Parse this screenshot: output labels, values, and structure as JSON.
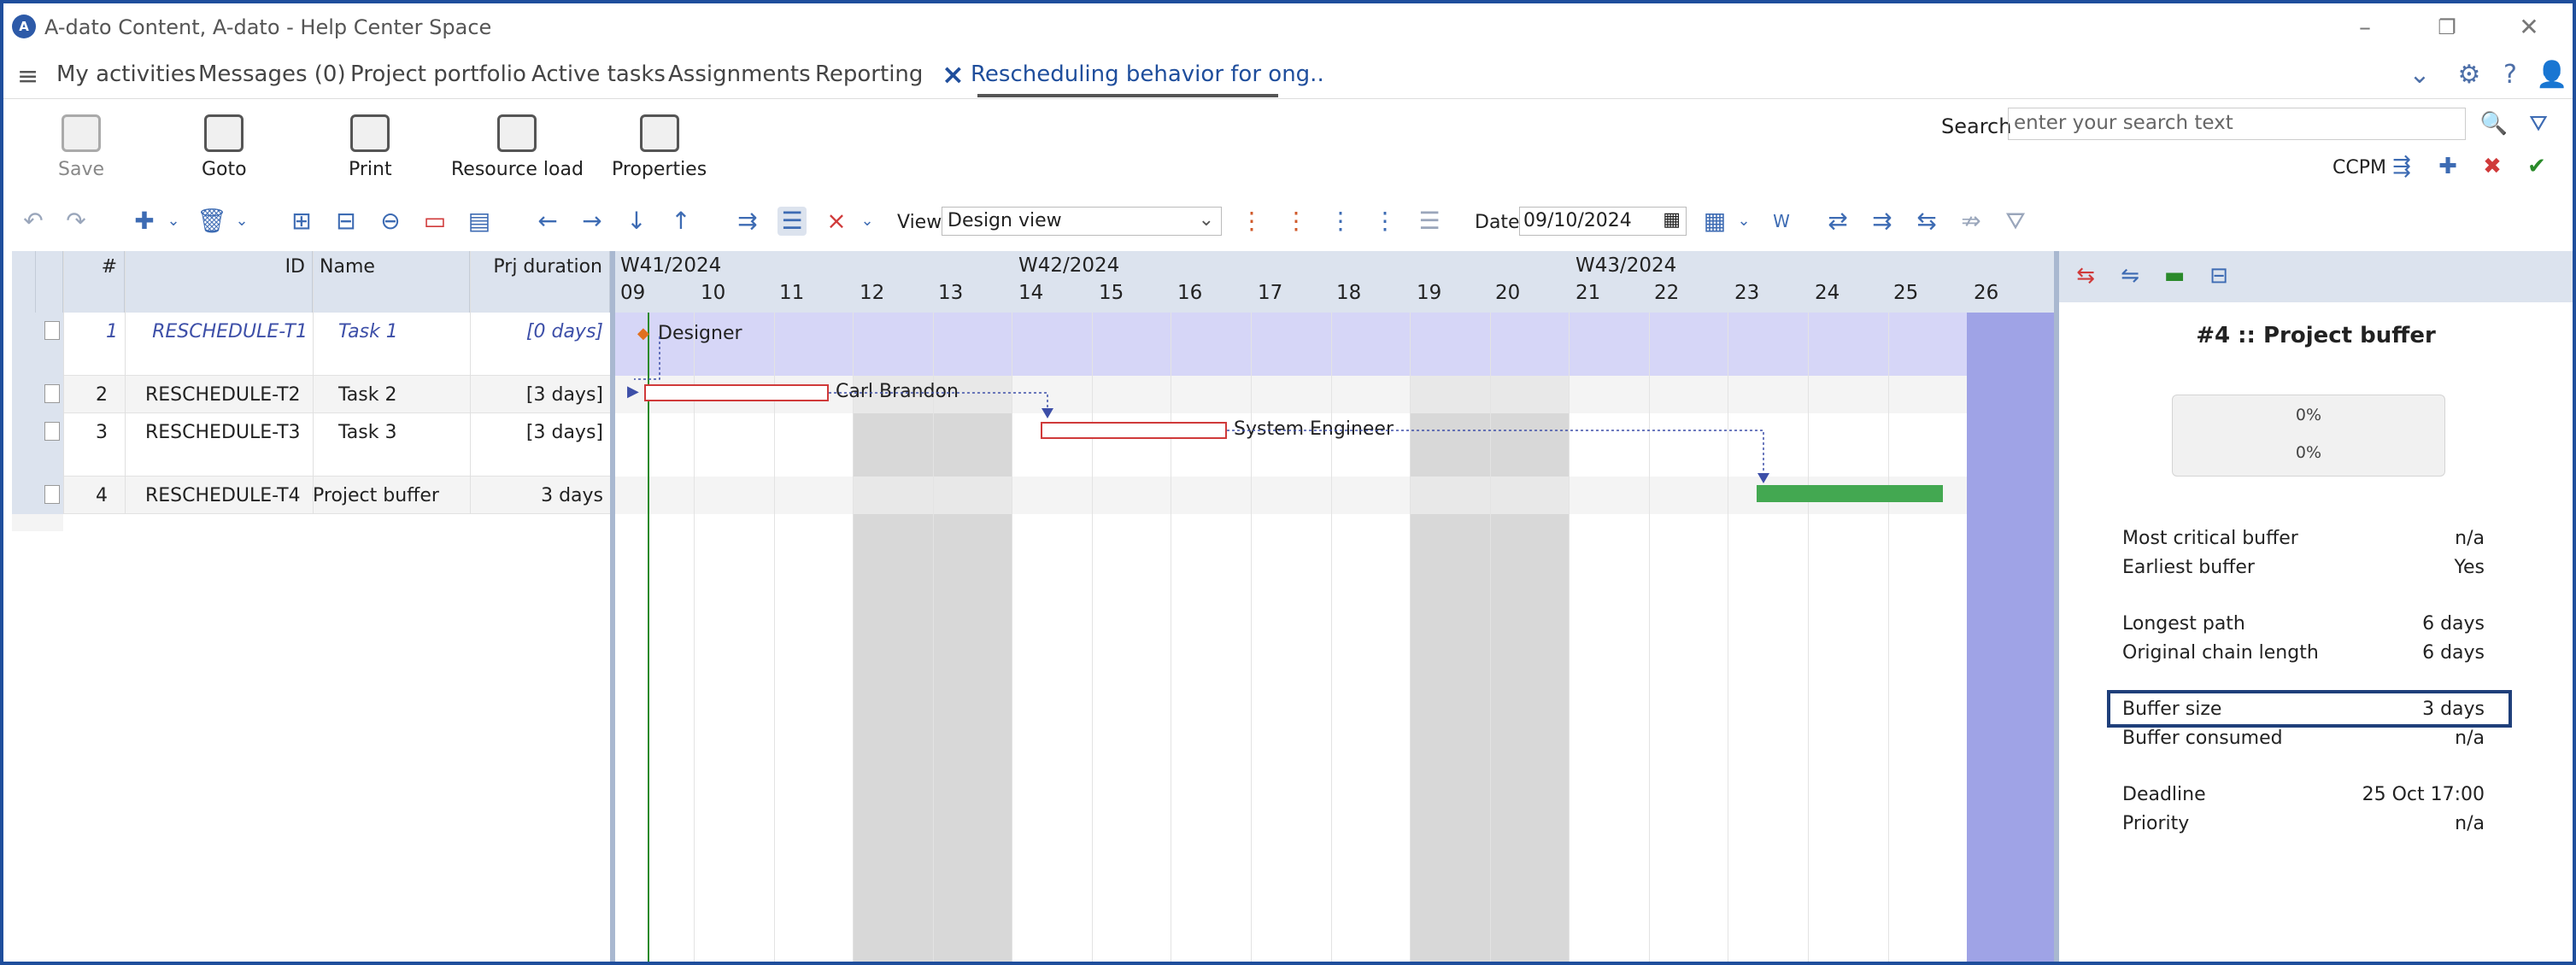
{
  "window": {
    "title": "A-dato Content, A-dato - Help Center Space",
    "logo_letter": "A"
  },
  "menu": {
    "items": [
      "My activities",
      "Messages (0)",
      "Project portfolio",
      "Active tasks",
      "Assignments",
      "Reporting"
    ],
    "active_tab": "Rescheduling behavior for ong.."
  },
  "ribbon": {
    "save": "Save",
    "goto": "Goto",
    "print": "Print",
    "resource_load": "Resource load",
    "properties": "Properties",
    "search_label": "Search",
    "search_placeholder": "enter your search text",
    "ccpm_label": "CCPM"
  },
  "toolbar": {
    "view_label": "View",
    "view_value": "Design view",
    "date_label": "Date",
    "date_value": "09/10/2024"
  },
  "grid": {
    "headers": {
      "num": "#",
      "id": "ID",
      "name": "Name",
      "duration": "Prj duration"
    },
    "rows": [
      {
        "num": "1",
        "id": "RESCHEDULE-T1",
        "name": "Task 1",
        "duration": "[0 days]"
      },
      {
        "num": "2",
        "id": "RESCHEDULE-T2",
        "name": "Task 2",
        "duration": "[3 days]"
      },
      {
        "num": "3",
        "id": "RESCHEDULE-T3",
        "name": "Task 3",
        "duration": "[3 days]"
      },
      {
        "num": "4",
        "id": "RESCHEDULE-T4",
        "name": "Project buffer",
        "duration": "3 days"
      }
    ]
  },
  "gantt": {
    "weeks": [
      "W41/2024",
      "W42/2024",
      "W43/2024"
    ],
    "days": [
      "09",
      "10",
      "11",
      "12",
      "13",
      "14",
      "15",
      "16",
      "17",
      "18",
      "19",
      "20",
      "21",
      "22",
      "23",
      "24",
      "25",
      "26"
    ],
    "labels": {
      "designer": "Designer",
      "carl": "Carl Brandon",
      "sys": "System Engineer"
    }
  },
  "panel": {
    "title": "#4 :: Project buffer",
    "gauge_top": "0%",
    "gauge_bottom": "0%",
    "fields": [
      {
        "label": "Most critical buffer",
        "value": "n/a"
      },
      {
        "label": "Earliest buffer",
        "value": "Yes"
      },
      {
        "label": "Longest path",
        "value": "6 days"
      },
      {
        "label": "Original chain length",
        "value": "6 days"
      },
      {
        "label": "Buffer size",
        "value": "3 days"
      },
      {
        "label": "Buffer consumed",
        "value": "n/a"
      },
      {
        "label": "Deadline",
        "value": "25 Oct 17:00"
      },
      {
        "label": "Priority",
        "value": "n/a"
      }
    ]
  },
  "colors": {
    "accent": "#1f4e9c",
    "critical_bar": "#d03a3a",
    "buffer_bar": "#43a851",
    "buffer_column": "#9fa3e6",
    "summary_row": "#d6d6f7"
  }
}
